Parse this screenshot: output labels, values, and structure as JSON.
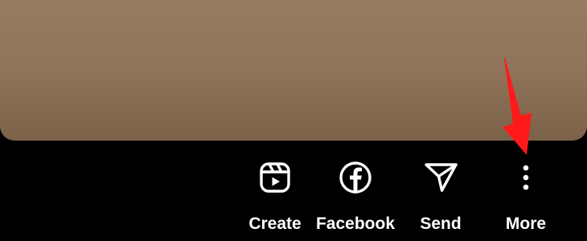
{
  "theme": {
    "background": "#000000",
    "preview_color": "#8f735a",
    "label_color": "#ffffff",
    "annotation_color": "#ff0000"
  },
  "share_actions": [
    {
      "label": "Create",
      "icon": "reels-create-icon"
    },
    {
      "label": "Facebook",
      "icon": "facebook-icon"
    },
    {
      "label": "Send",
      "icon": "send-paper-plane-icon"
    },
    {
      "label": "More",
      "icon": "more-vertical-dots-icon"
    }
  ],
  "annotation": {
    "type": "arrow",
    "points_to": "More",
    "color": "#ff0000"
  }
}
